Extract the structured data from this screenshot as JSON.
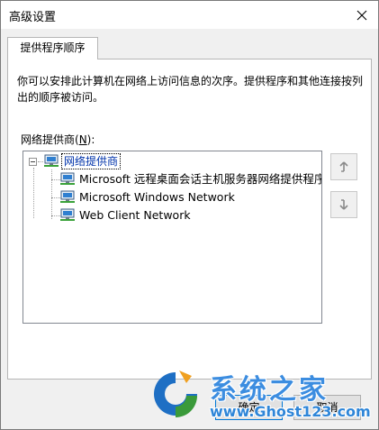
{
  "window": {
    "title": "高级设置"
  },
  "tabs": [
    {
      "label": "提供程序顺序",
      "selected": true
    }
  ],
  "description": "你可以安排此计算机在网络上访问信息的次序。提供程序和其他连接按列出的顺序被访问。",
  "providers_group": {
    "label_prefix": "网络提供商(",
    "accel_key": "N",
    "label_suffix": "):"
  },
  "tree": {
    "root": {
      "label": "网络提供商",
      "icon": "network-computer-icon",
      "expanded": true
    },
    "children": [
      {
        "label": "Microsoft 远程桌面会话主机服务器网络提供程序",
        "icon": "network-computer-icon"
      },
      {
        "label": "Microsoft Windows Network",
        "icon": "network-computer-icon"
      },
      {
        "label": "Web Client Network",
        "icon": "network-computer-icon"
      }
    ]
  },
  "side_buttons": [
    {
      "name": "move-up",
      "icon": "arrow-up-icon"
    },
    {
      "name": "move-down",
      "icon": "arrow-down-icon"
    }
  ],
  "footer": {
    "ok_label": "确定",
    "cancel_label": "取消"
  },
  "watermark": {
    "title": "系统之家",
    "url": "www.Ghost123.com"
  },
  "colors": {
    "selection_text": "#0033aa",
    "accent_border": "#0078d7",
    "watermark": "#3c8de0"
  }
}
